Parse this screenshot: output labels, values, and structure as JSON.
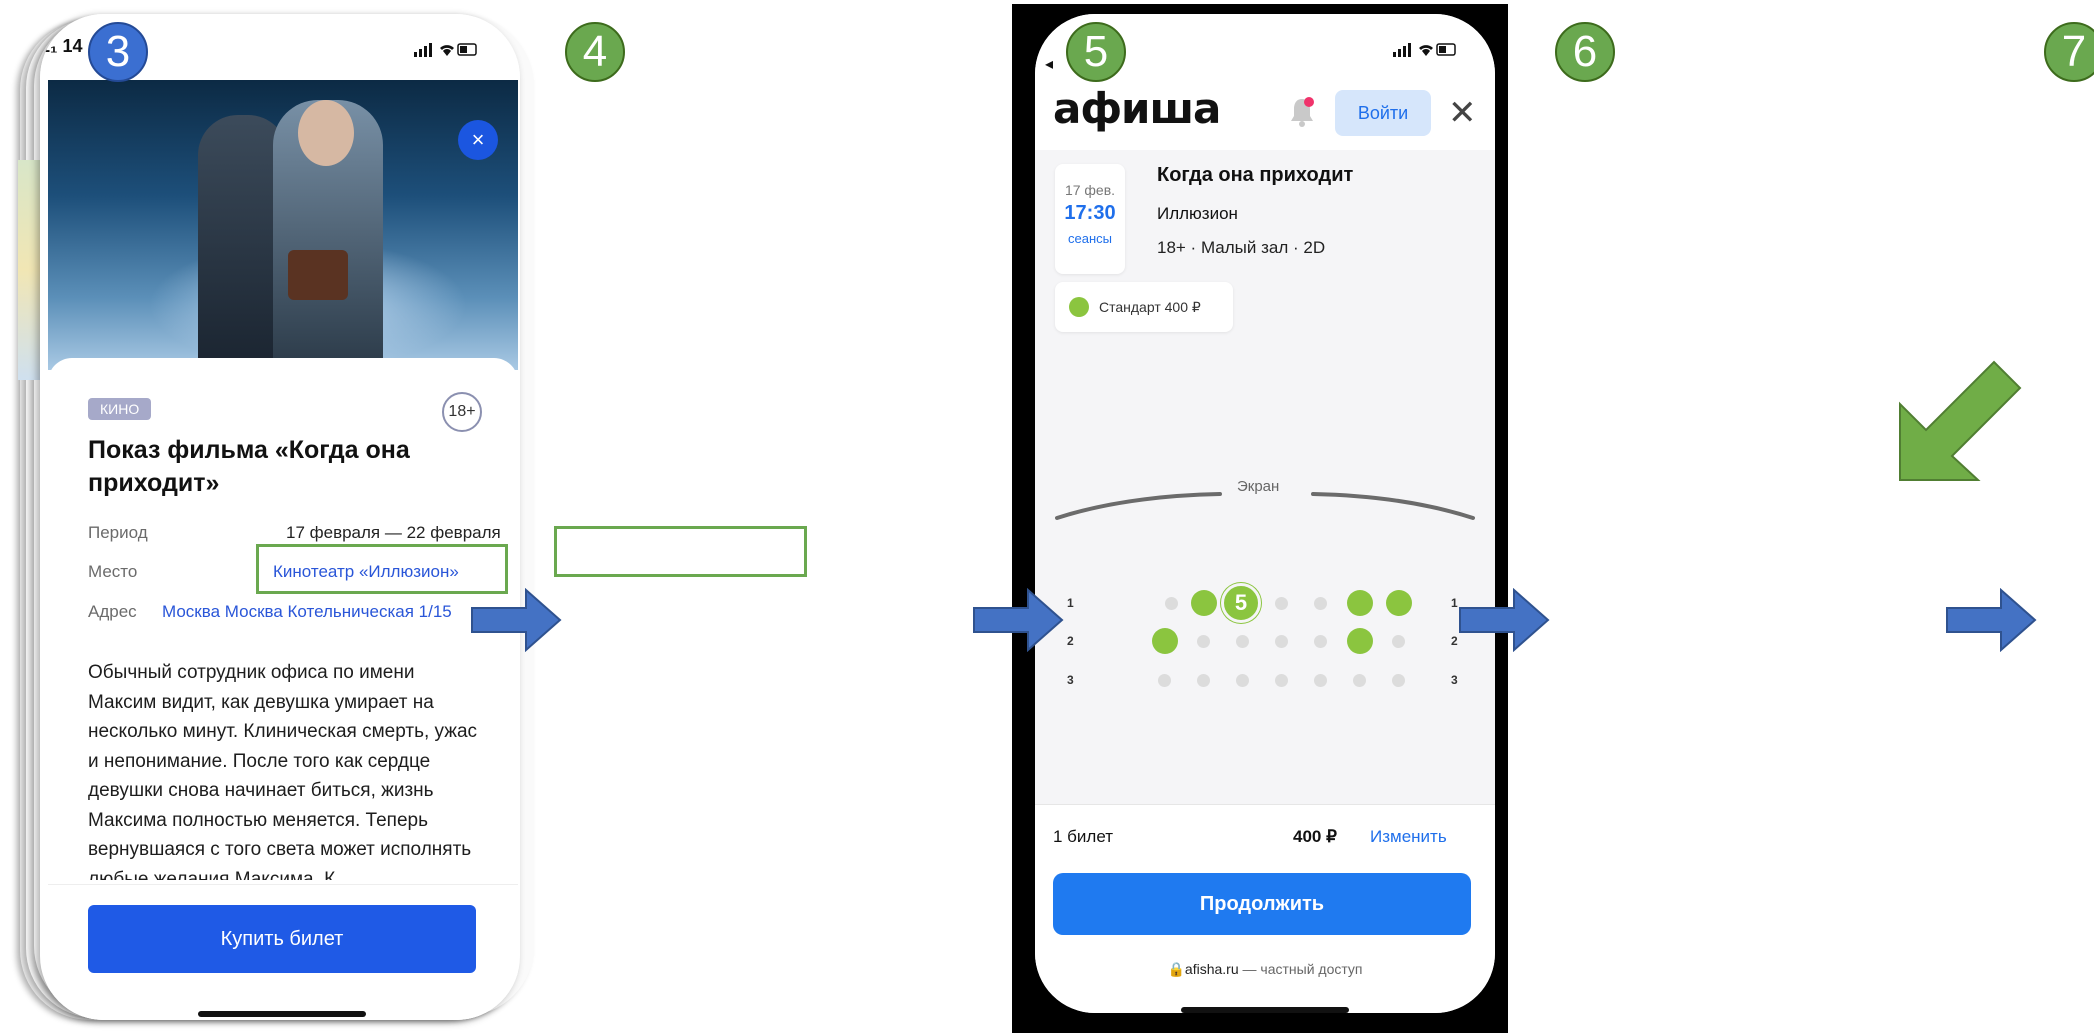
{
  "steps": {
    "s3": "3",
    "s4": "4",
    "s5": "5",
    "s6": "6",
    "s7": "7"
  },
  "phone1": {
    "status_time": "1₁ 14",
    "close_icon": "×",
    "tag": "КИНО",
    "age": "18+",
    "title": "Показ фильма «Когда она приходит»",
    "period_label": "Период",
    "period_value": "17 февраля — 22 февраля",
    "place_label": "Место",
    "place_value": "Кинотеатр «Иллюзион»",
    "address_label": "Адрес",
    "address_value": "Москва Москва Котельническая 1/15",
    "description": "Обычный сотрудник офиса по имени Максим видит, как девушка умирает на несколько минут. Клиническая смерть, ужас и непонимание. После того как сердце девушки снова начинает биться, жизнь Максима полностью меняется. Теперь вернувшаяся с того света может исполнять любые желания Максима. К",
    "buy_button": "Купить билет"
  },
  "phone2": {
    "back_glyph": "◂",
    "logo": "афиша",
    "login_button": "Войти",
    "close_glyph": "✕",
    "date": "17 фев.",
    "time": "17:30",
    "sessions": "сеансы",
    "event_title": "Когда она приходит",
    "venue": "Иллюзион",
    "meta": "18+ · Малый зал · 2D",
    "price_chip": "Стандарт 400 ₽",
    "screen_label": "Экран",
    "rows": [
      "1",
      "2",
      "3"
    ],
    "selected_seat": "5",
    "tickets": "1 билет",
    "total": "400 ₽",
    "change": "Изменить",
    "continue_button": "Продолжить",
    "footer_site": "afisha.ru",
    "footer_rest": " — частный доступ"
  },
  "colors": {
    "badge_green": "#6aa84f",
    "badge_blue": "#3b6fd1",
    "arrow_blue": "#4472c4",
    "arrow_green": "#70ad47",
    "accent": "#1f7af0"
  },
  "icons": [
    "close-icon",
    "bell-icon",
    "lock-icon",
    "signal-icon",
    "wifi-icon",
    "battery-icon",
    "arrow-right-icon",
    "arrow-down-left-icon"
  ]
}
